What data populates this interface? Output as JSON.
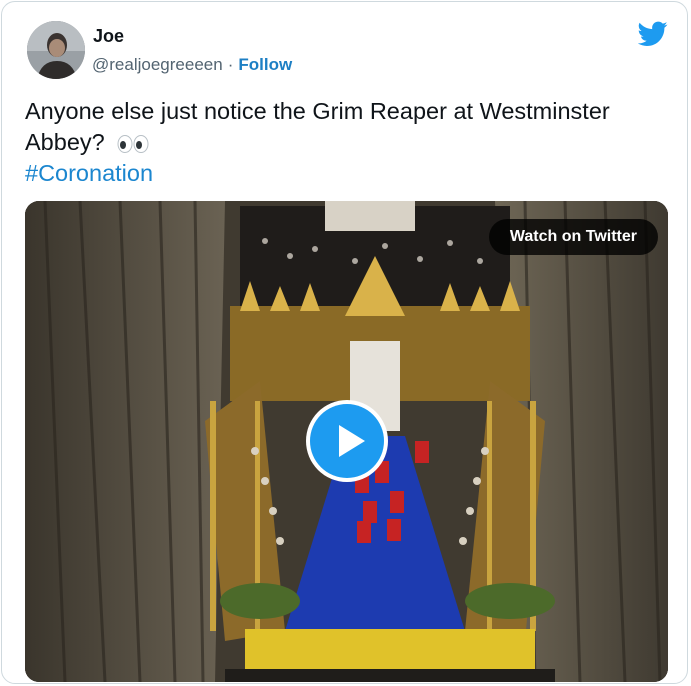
{
  "tweet": {
    "author": {
      "name": "Joe",
      "handle": "@realjoegreeeen",
      "separator": "·",
      "follow_label": "Follow",
      "avatar_icon": "avatar-photo"
    },
    "brand_icon": "twitter-bird-icon",
    "text": "Anyone else just notice the Grim Reaper at Westminster Abbey?",
    "emoji": "eyes-emoji",
    "hashtag": "#Coronation"
  },
  "media": {
    "watch_label": "Watch on Twitter",
    "play_icon": "play-icon",
    "description_icon": "video-thumbnail"
  },
  "colors": {
    "link": "#1d7fc4",
    "twitter_blue": "#1d9bf0",
    "text": "#0f1419",
    "secondary": "#536471",
    "border": "#cfd9de"
  }
}
